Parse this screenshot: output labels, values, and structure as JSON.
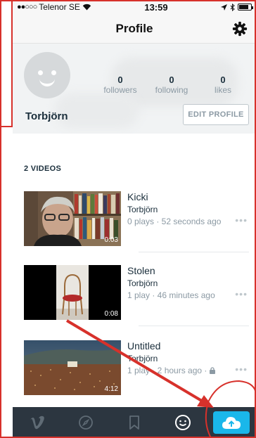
{
  "status_bar": {
    "carrier": "Telenor SE",
    "time": "13:59",
    "battery_level": 0.8
  },
  "navbar": {
    "title": "Profile",
    "settings_icon": "gear-icon"
  },
  "profile": {
    "avatar_icon": "smiley-face-icon",
    "username": "Torbjörn",
    "edit_label": "EDIT PROFILE",
    "stats": [
      {
        "count": "0",
        "label": "followers"
      },
      {
        "count": "0",
        "label": "following"
      },
      {
        "count": "0",
        "label": "likes"
      }
    ]
  },
  "videos": {
    "heading": "2 VIDEOS",
    "items": [
      {
        "title": "Kicki",
        "owner": "Torbjörn",
        "meta": "0 plays · 52 seconds ago",
        "duration": "0:03",
        "locked": false
      },
      {
        "title": "Stolen",
        "owner": "Torbjörn",
        "meta": "1 play · 46 minutes ago",
        "duration": "0:08",
        "locked": false
      },
      {
        "title": "Untitled",
        "owner": "Torbjörn",
        "meta": "1 play · 2 hours ago · ",
        "duration": "4:12",
        "locked": true
      }
    ],
    "more_glyph": "•••"
  },
  "tabbar": {
    "items": [
      {
        "name": "vimeo-logo-icon"
      },
      {
        "name": "compass-icon"
      },
      {
        "name": "bookmark-icon"
      },
      {
        "name": "profile-smiley-icon"
      },
      {
        "name": "upload-cloud-icon"
      }
    ],
    "upload_color": "#1ab7ea",
    "bar_color": "#2c3640"
  },
  "colors": {
    "accent": "#1ab7ea",
    "annotation": "#d7312b",
    "text": "#1a2e3b",
    "muted": "#8c9aa4"
  }
}
